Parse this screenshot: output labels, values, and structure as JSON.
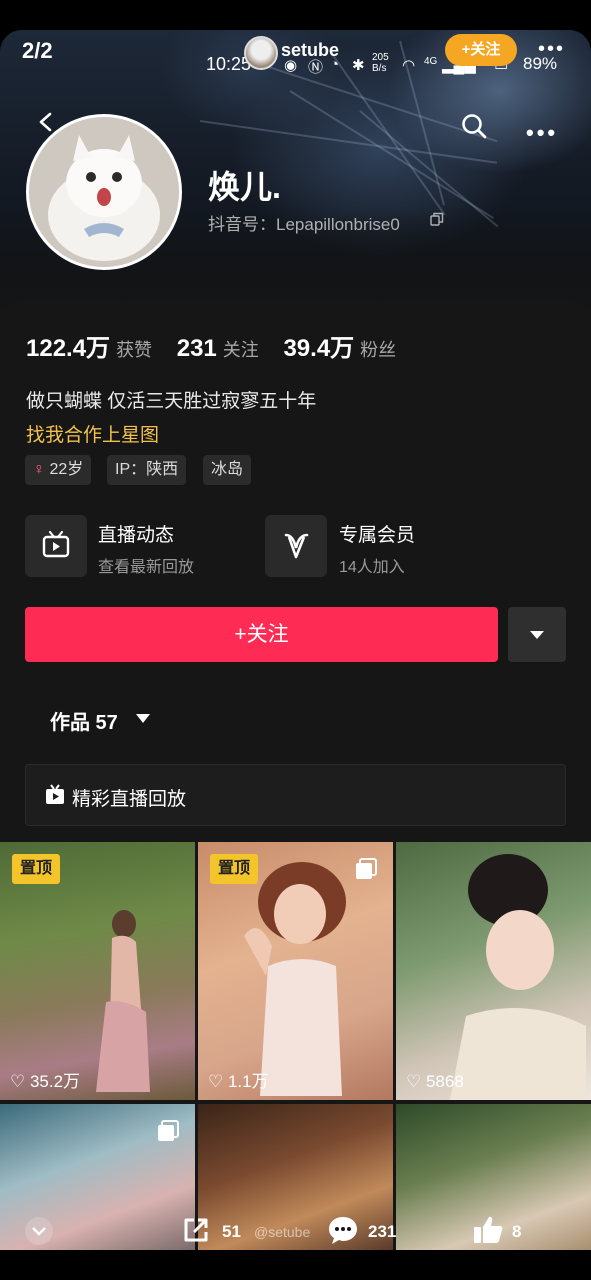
{
  "viewer": {
    "page_counter": "2/2"
  },
  "status_bar": {
    "time": "10:25",
    "net_speed": "205 B/s",
    "signal": "4G",
    "battery": "89%"
  },
  "overlay": {
    "username": "setube",
    "follow_chip": "+关注"
  },
  "profile": {
    "name": "焕儿.",
    "douyin_id": "抖音号：Lepapillonbrise0",
    "stats": [
      {
        "value": "122.4万",
        "label": "获赞"
      },
      {
        "value": "231",
        "label": "关注"
      },
      {
        "value": "39.4万",
        "label": "粉丝"
      }
    ],
    "bio": "做只蝴蝶 仅活三天胜过寂寥五十年",
    "star_link": "找我合作上星图",
    "tags": [
      "22岁",
      "IP：陕西",
      "冰岛"
    ],
    "features": [
      {
        "title": "直播动态",
        "subtitle": "查看最新回放",
        "icon": "tv-icon"
      },
      {
        "title": "专属会员",
        "subtitle": "14人加入",
        "icon": "v-icon"
      }
    ],
    "follow_button": "+关注",
    "works_tab": "作品 57",
    "live_replay": "精彩直播回放"
  },
  "grid": [
    {
      "pinned": "置顶",
      "likes": "35.2万",
      "multi": false
    },
    {
      "pinned": "置顶",
      "likes": "1.1万",
      "multi": true
    },
    {
      "pinned": "",
      "likes": "5868",
      "multi": false
    },
    {
      "pinned": "",
      "likes": "",
      "multi": true
    },
    {
      "pinned": "",
      "likes": "",
      "multi": false
    },
    {
      "pinned": "",
      "likes": "",
      "multi": false
    }
  ],
  "bottom_bar": {
    "share_count": "51",
    "watermark": "@setube",
    "comment_count": "231",
    "like_count": "8"
  },
  "colors": {
    "accent": "#fe2c55",
    "pin": "#f3c52a",
    "follow_chip": "#f5a623",
    "star_link": "#f2c14e"
  }
}
